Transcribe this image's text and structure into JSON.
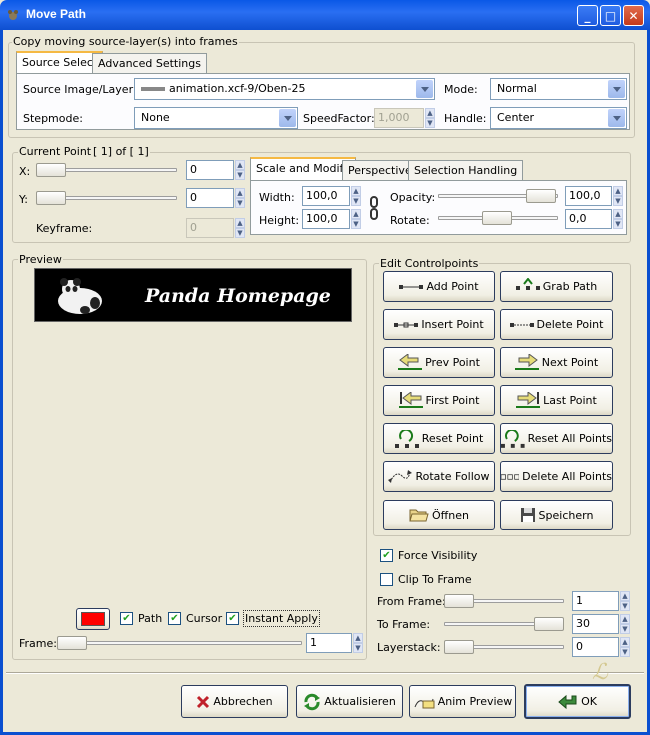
{
  "window": {
    "title": "Move Path",
    "minimize": "_",
    "maximize": "□",
    "close": "✕"
  },
  "copy_group": {
    "label": "Copy moving source-layer(s) into frames"
  },
  "tabs_top": [
    "Source Select",
    "Advanced Settings"
  ],
  "source": {
    "label": "Source Image/Layer:",
    "value": "animation.xcf-9/Oben-25",
    "mode_label": "Mode:",
    "mode_value": "Normal",
    "stepmode_label": "Stepmode:",
    "stepmode_value": "None",
    "speedfactor_label": "SpeedFactor:",
    "speedfactor_value": "1,000",
    "handle_label": "Handle:",
    "handle_value": "Center"
  },
  "current_point": {
    "label": "Current Point:",
    "text": "[ 1] of [ 1]",
    "x_label": "X:",
    "x_value": "0",
    "y_label": "Y:",
    "y_value": "0",
    "keyframe_label": "Keyframe:",
    "keyframe_value": "0"
  },
  "tabs_mid": [
    "Scale and Modify",
    "Perspective",
    "Selection Handling"
  ],
  "scale": {
    "width_label": "Width:",
    "width_value": "100,0",
    "height_label": "Height:",
    "height_value": "100,0",
    "opacity_label": "Opacity:",
    "opacity_value": "100,0",
    "rotate_label": "Rotate:",
    "rotate_value": "0,0"
  },
  "preview": {
    "label": "Preview",
    "banner_text": "Panda Homepage",
    "path_label": "Path",
    "cursor_label": "Cursor",
    "instant_label": "Instant Apply",
    "frame_label": "Frame:",
    "frame_value": "1",
    "color": "#ff0000"
  },
  "edit": {
    "label": "Edit Controlpoints",
    "buttons": [
      "Add Point",
      "Grab Path",
      "Insert Point",
      "Delete Point",
      "Prev Point",
      "Next Point",
      "First Point",
      "Last Point",
      "Reset Point",
      "Reset All Points",
      "Rotate Follow",
      "Delete All Points",
      "Öffnen",
      "Speichern"
    ]
  },
  "options": {
    "force_visibility": "Force Visibility",
    "clip_to_frame": "Clip To Frame",
    "from_frame_label": "From Frame:",
    "from_frame_value": "1",
    "to_frame_label": "To Frame:",
    "to_frame_value": "30",
    "layerstack_label": "Layerstack:",
    "layerstack_value": "0"
  },
  "bottom": {
    "cancel": "Abbrechen",
    "refresh": "Aktualisieren",
    "anim_preview": "Anim Preview",
    "ok": "OK"
  }
}
